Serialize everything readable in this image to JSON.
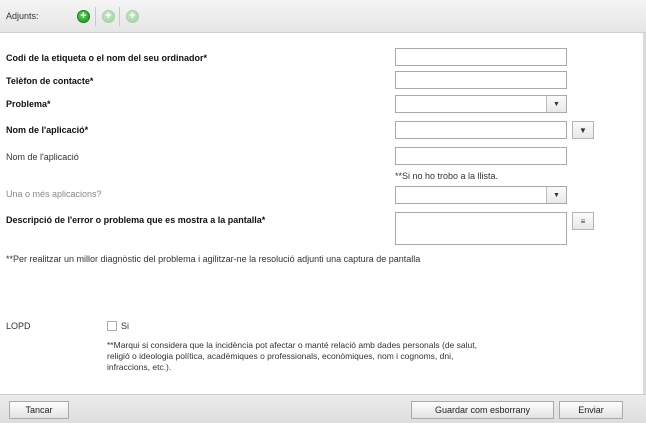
{
  "toolbar": {
    "label": "Adjunts:",
    "buttons": [
      {
        "icon": "add-icon",
        "symbol": "+",
        "state": "enabled"
      },
      {
        "icon": "add-icon",
        "symbol": "+",
        "state": "disabled"
      },
      {
        "icon": "add-icon",
        "symbol": "+",
        "state": "disabled"
      }
    ]
  },
  "form": {
    "equipment_code_label": "Codi de la etiqueta o el nom del seu ordinador*",
    "phone_label": "Telèfon de contacte*",
    "problem_label": "Problema*",
    "app_name_label": "Nom de l'aplicació*",
    "app_name_free_label": "Nom de l'aplicació",
    "app_name_hint": "**Si no ho trobo a la llista.",
    "multiple_apps_label": "Una o més aplicacions?",
    "description_label": "Descripció de l'error o problema que es mostra a la pantalla*",
    "screenshot_hint": "**Per realitzar un millor diagnòstic del problema i agilitzar-ne la resolució adjunti una captura de pantalla",
    "lopd_label": "LOPD",
    "lopd_checkbox_label": "Si",
    "lopd_note": "**Marqui si considera que la incidència pot afectar o manté relació amb dades personals (de salut, religió o ideologia política, acadèmiques o professionals, econòmiques, nom i cognoms, dni, infraccions, etc.)."
  },
  "footer": {
    "cancel_label": "Tancar",
    "save_draft_label": "Guardar com esborrany",
    "send_label": "Enviar"
  },
  "colors": {
    "add_enabled": "#1e8a1e",
    "add_disabled": "#a8cfa8",
    "toolbar_bg": "#e6e6e6"
  }
}
